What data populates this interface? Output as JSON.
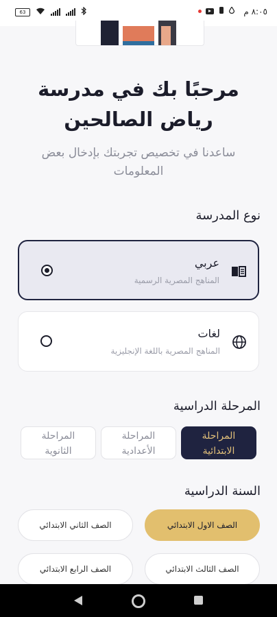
{
  "status_bar": {
    "time": "٨:٠٥ م",
    "battery": "63"
  },
  "header": {
    "title": "مرحبًا بك في مدرسة رياض الصالحين",
    "subtitle": "ساعدنا في تخصيص تجربتك بإدخال بعض المعلومات"
  },
  "school_type": {
    "label": "نوع المدرسة",
    "options": [
      {
        "title": "عربي",
        "description": "المناهج المصرية الرسمية",
        "icon": "book-icon",
        "selected": true
      },
      {
        "title": "لغات",
        "description": "المناهج المصرية باللغة الإنجليزية",
        "icon": "globe-icon",
        "selected": false
      }
    ]
  },
  "stage": {
    "label": "المرحلة الدراسية",
    "options": [
      {
        "line1": "المراحلة",
        "line2": "الابتدائية",
        "selected": true
      },
      {
        "line1": "المراحلة",
        "line2": "الأعدادية",
        "selected": false
      },
      {
        "line1": "المراحلة",
        "line2": "الثانوية",
        "selected": false
      }
    ]
  },
  "year": {
    "label": "السنة الدراسية",
    "options": [
      {
        "label": "الصف الاول الابتدائي",
        "selected": true
      },
      {
        "label": "الصف الثاني الابتدائي",
        "selected": false
      },
      {
        "label": "الصف الثالث الابتدائي",
        "selected": false
      },
      {
        "label": "الصف الرابع الابتدائي",
        "selected": false
      }
    ]
  },
  "colors": {
    "primary": "#1f2340",
    "accent": "#e2bf6e",
    "selected_card_bg": "#e9e9f1",
    "muted_text": "#8a8c98"
  }
}
